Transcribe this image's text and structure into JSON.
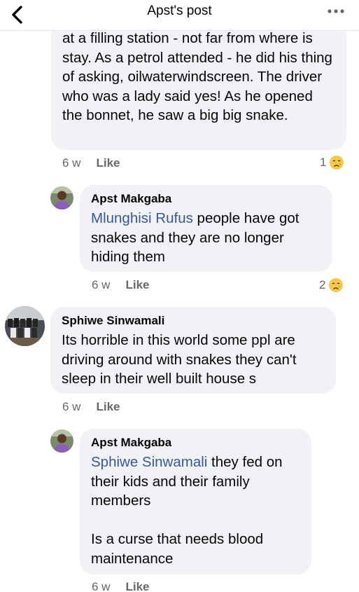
{
  "header": {
    "title": "Apst's post",
    "back_icon": "chevron-left-icon",
    "more_icon": "more-horizontal-icon"
  },
  "comments": [
    {
      "author": "",
      "text": "at a filling station - not far from where is stay. As a petrol attended - he did his thing of asking, oilwaterwindscreen. The driver who was a lady said yes! As he opened the bonnet, he saw a big big snake.",
      "time": "6 w",
      "like_label": "Like",
      "reaction_count": "1",
      "reaction_icon": "crying-face-icon"
    },
    {
      "author": "Apst Makgaba",
      "mention": "Mlunghisi Rufus",
      "text": " people have got snakes and they are no longer hiding them",
      "time": "6 w",
      "like_label": "Like",
      "reaction_count": "2",
      "reaction_icon": "crying-face-icon"
    },
    {
      "author": "Sphiwe Sinwamali",
      "text": "Its horrible in this world some ppl are driving around with snakes they can't sleep in their well built house s",
      "time": "6 w",
      "like_label": "Like"
    },
    {
      "author": "Apst Makgaba",
      "mention": "Sphiwe Sinwamali",
      "text": " they fed on their kids and their family members\n\nIs a curse that needs blood maintenance",
      "time": "6 w",
      "like_label": "Like"
    }
  ],
  "colors": {
    "bubble": "#f0f2f5",
    "mention": "#385898",
    "meta": "#65676b"
  }
}
